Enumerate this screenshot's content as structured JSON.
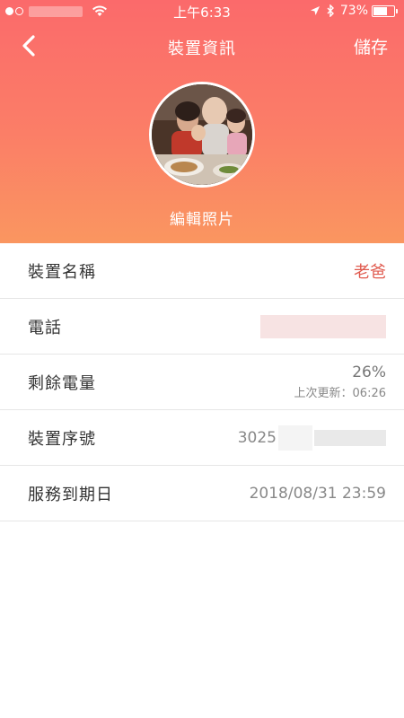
{
  "status_bar": {
    "time": "上午6:33",
    "battery_text": "73%",
    "battery_level": 0.73,
    "icons": [
      "signal-dots-icon",
      "wifi-icon",
      "location-arrow-icon",
      "bluetooth-icon",
      "battery-icon"
    ]
  },
  "nav": {
    "back_icon": "chevron-left-icon",
    "title": "裝置資訊",
    "save_label": "儲存"
  },
  "profile": {
    "edit_photo_label": "編輯照片"
  },
  "rows": {
    "device_name": {
      "label": "裝置名稱",
      "value": "老爸"
    },
    "phone": {
      "label": "電話",
      "value": ""
    },
    "battery": {
      "label": "剩餘電量",
      "percent": "26%",
      "last_update": "上次更新：06:26"
    },
    "serial": {
      "label": "裝置序號",
      "value_prefix": "3025"
    },
    "service_expiry": {
      "label": "服務到期日",
      "value": "2018/08/31 23:59"
    }
  },
  "colors": {
    "header_top": "#fb6a6b",
    "header_bottom": "#fa9660",
    "accent": "#e05a4e"
  }
}
